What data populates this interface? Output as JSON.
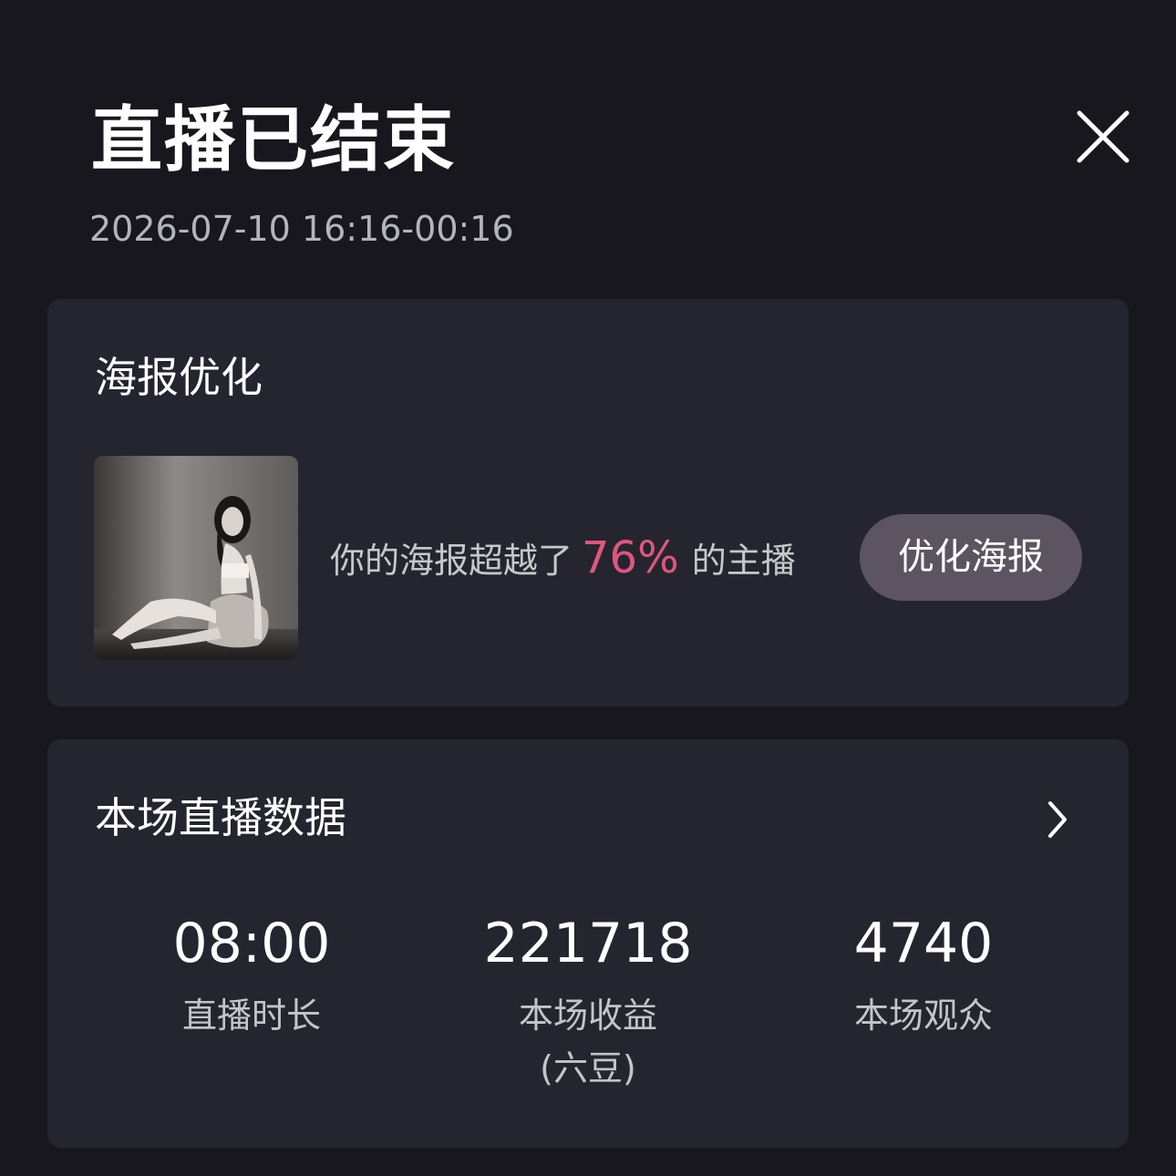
{
  "header": {
    "title": "直播已结束",
    "time_range": "2026-07-10 16:16-00:16"
  },
  "icons": {
    "close": "close-icon",
    "chevron": "chevron-right-icon"
  },
  "poster_card": {
    "title": "海报优化",
    "desc_prefix": "你的海报超越了",
    "percent": "76%",
    "desc_suffix": "的主播",
    "button_label": "优化海报"
  },
  "data_card": {
    "title": "本场直播数据",
    "stats": [
      {
        "value": "08:00",
        "label": "直播时长",
        "sub": ""
      },
      {
        "value": "221718",
        "label": "本场收益",
        "sub": "(六豆)"
      },
      {
        "value": "4740",
        "label": "本场观众",
        "sub": ""
      }
    ]
  },
  "colors": {
    "background": "#17171d",
    "card": "#25252f",
    "accent_percent": "#e0567c",
    "button": "#5c5561"
  }
}
